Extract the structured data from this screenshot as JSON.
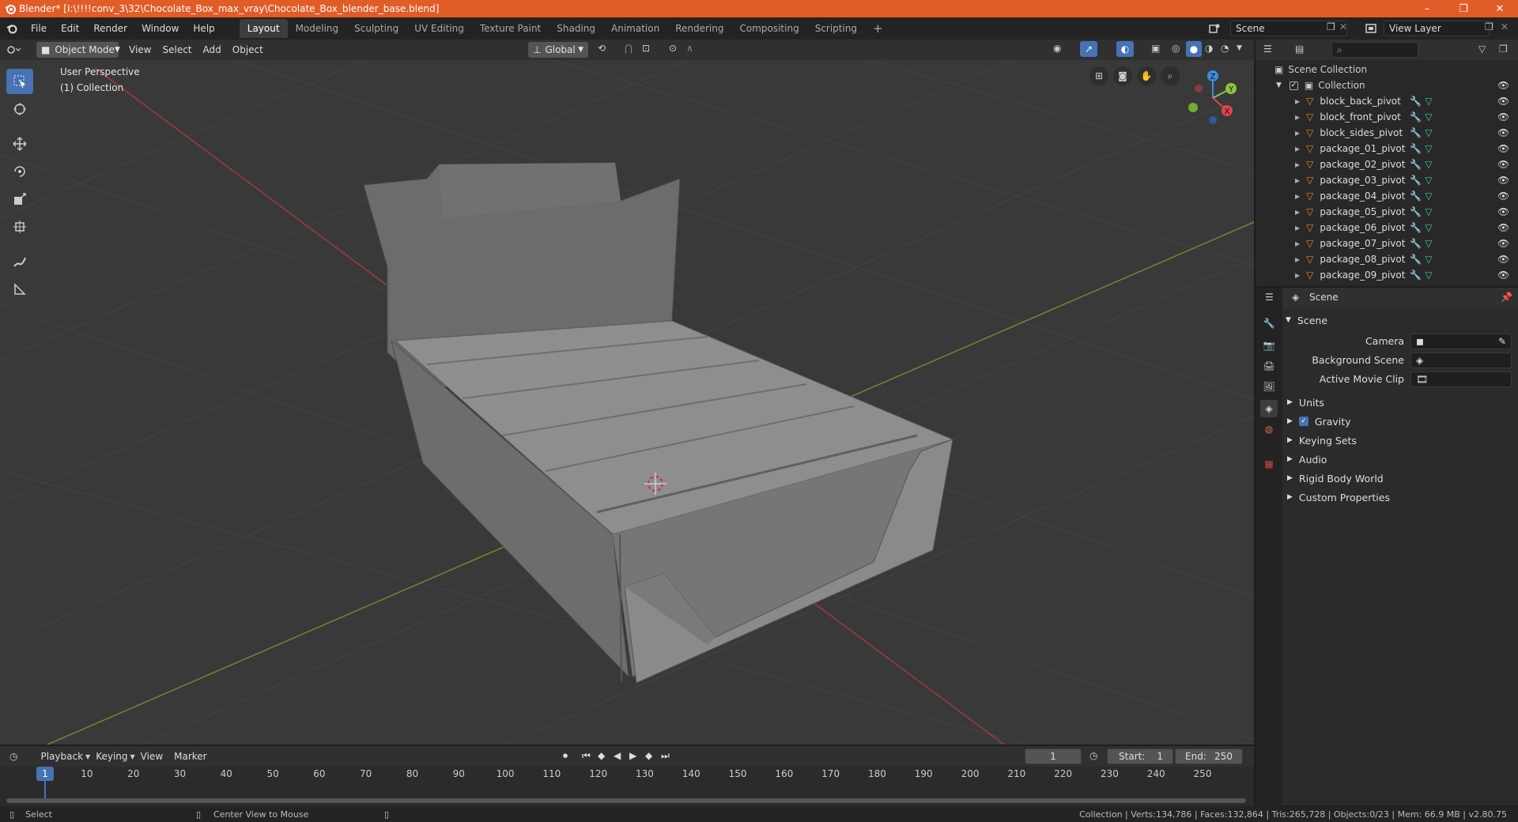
{
  "window": {
    "title": "Blender* [I:\\!!!!conv_3\\32\\Chocolate_Box_max_vray\\Chocolate_Box_blender_base.blend]",
    "minimize": "–",
    "maximize": "❐",
    "close": "✕"
  },
  "menu": [
    "File",
    "Edit",
    "Render",
    "Window",
    "Help"
  ],
  "workspaces": [
    "Layout",
    "Modeling",
    "Sculpting",
    "UV Editing",
    "Texture Paint",
    "Shading",
    "Animation",
    "Rendering",
    "Compositing",
    "Scripting"
  ],
  "add_workspace": "+",
  "scene_field": "Scene",
  "view_layer_field": "View Layer",
  "viewport_header": {
    "mode": "Object Mode",
    "menus": [
      "View",
      "Select",
      "Add",
      "Object"
    ],
    "transform": "Global"
  },
  "viewport": {
    "perspective": "User Perspective",
    "collection": "(1) Collection",
    "gizmo": {
      "z": "Z",
      "y": "Y",
      "x": "X"
    }
  },
  "outliner": {
    "root": "Scene Collection",
    "collection": "Collection",
    "items": [
      "block_back_pivot",
      "block_front_pivot",
      "block_sides_pivot",
      "package_01_pivot",
      "package_02_pivot",
      "package_03_pivot",
      "package_04_pivot",
      "package_05_pivot",
      "package_06_pivot",
      "package_07_pivot",
      "package_08_pivot",
      "package_09_pivot"
    ]
  },
  "properties": {
    "header": "Scene",
    "panel": "Scene",
    "camera_label": "Camera",
    "background_label": "Background Scene",
    "movie_clip_label": "Active Movie Clip",
    "sections": [
      "Units",
      "Gravity",
      "Keying Sets",
      "Audio",
      "Rigid Body World",
      "Custom Properties"
    ],
    "gravity_checked": true
  },
  "timeline": {
    "menus": [
      "Playback",
      "Keying",
      "View",
      "Marker"
    ],
    "current_frame": "1",
    "start_label": "Start:",
    "start": "1",
    "end_label": "End:",
    "end": "250",
    "ticks": [
      "10",
      "20",
      "30",
      "40",
      "50",
      "60",
      "70",
      "80",
      "90",
      "100",
      "110",
      "120",
      "130",
      "140",
      "150",
      "160",
      "170",
      "180",
      "190",
      "200",
      "210",
      "220",
      "230",
      "240",
      "250"
    ],
    "playhead": "1"
  },
  "status": {
    "left": "Select",
    "middle": "Center View to Mouse",
    "right": "Collection | Verts:134,786 | Faces:132,864 | Tris:265,728 | Objects:0/23 | Mem: 66.9 MB | v2.80.75"
  },
  "colors": {
    "title_bar": "#e25c27",
    "accent": "#4772b3",
    "x_axis": "#e0434f",
    "y_axis": "#8bc43f",
    "z_axis": "#3a8ee6"
  }
}
